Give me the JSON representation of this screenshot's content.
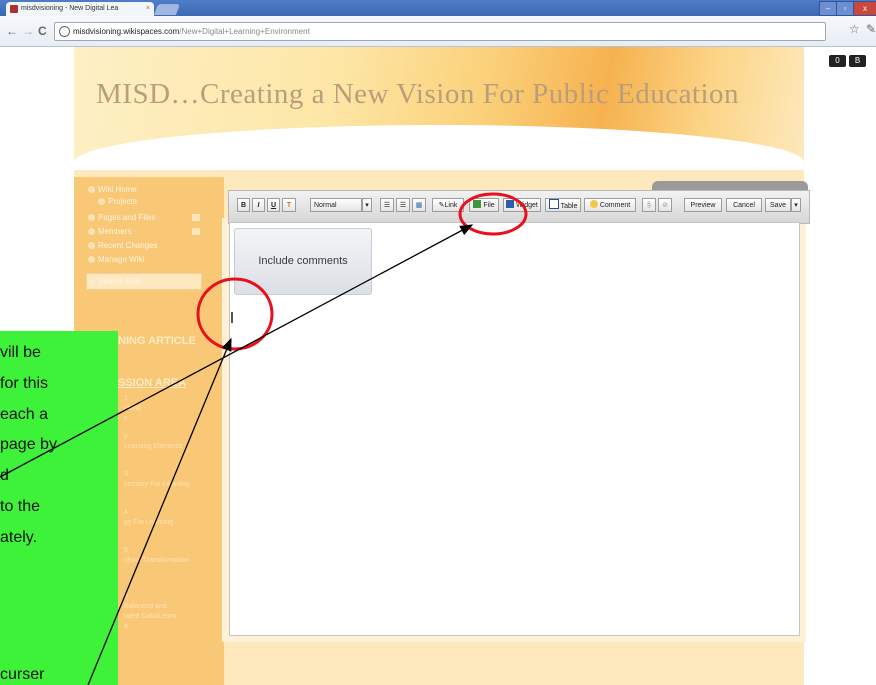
{
  "browser": {
    "tab_title": "misdvisioning - New Digital Lea",
    "tab_close": "×",
    "url_host": "misdvisioning.wikispaces.com",
    "url_path": "/New+Digital+Learning+Environment",
    "back_glyph": "←",
    "forward_glyph": "→",
    "reload_glyph": "C",
    "star_glyph": "☆",
    "wrench_glyph": "✎",
    "win_min": "–",
    "win_max": "▫",
    "win_close": "x",
    "ext_1": "0",
    "ext_2": "B"
  },
  "site": {
    "title": "MISD…Creating a New Vision For Public Education"
  },
  "sidebar": {
    "items": [
      {
        "label": "Wiki Home",
        "icon": "home-icon"
      },
      {
        "label": "Projects",
        "icon": "projects-icon"
      },
      {
        "label": "Pages and Files",
        "icon": "pages-icon"
      },
      {
        "label": "Members",
        "icon": "members-icon"
      },
      {
        "label": "Recent Changes",
        "icon": "calendar-icon"
      },
      {
        "label": "Manage Wiki",
        "icon": "manage-icon"
      }
    ],
    "search_placeholder": "Search Wiki",
    "heading_1": "NING ARTICLE",
    "heading_2": "SSION AREA",
    "links": [
      "1",
      "ching",
      "s",
      "",
      "y",
      "Learning Elements",
      "",
      "3",
      "cessary For Learning",
      "",
      "4",
      "gy For Learning",
      "",
      "5",
      "chool Transformation",
      "",
      "6",
      "Balanced and",
      "uded Data/Learn",
      "a"
    ]
  },
  "toolbar": {
    "bold": "B",
    "italic": "I",
    "underline": "U",
    "color": "T",
    "style_select": "Normal",
    "select_arrow": "▾",
    "link": "Link",
    "file": "File",
    "widget": "Widget",
    "table": "Table",
    "comment": "Comment",
    "preview": "Preview",
    "cancel": "Cancel",
    "save": "Save",
    "save_arrow": "▾"
  },
  "editor": {
    "comment_widget_label": "Include comments"
  },
  "callout": {
    "lines": [
      "vill be",
      "for this",
      "each a",
      "page by",
      "d",
      "to the",
      "ately.",
      "",
      "curser"
    ]
  },
  "colors": {
    "callout_bg": "#3ef23a",
    "highlight_circle": "#e8101c",
    "sidebar_bg": "#f9c876",
    "page_bg": "#fde9bd"
  }
}
